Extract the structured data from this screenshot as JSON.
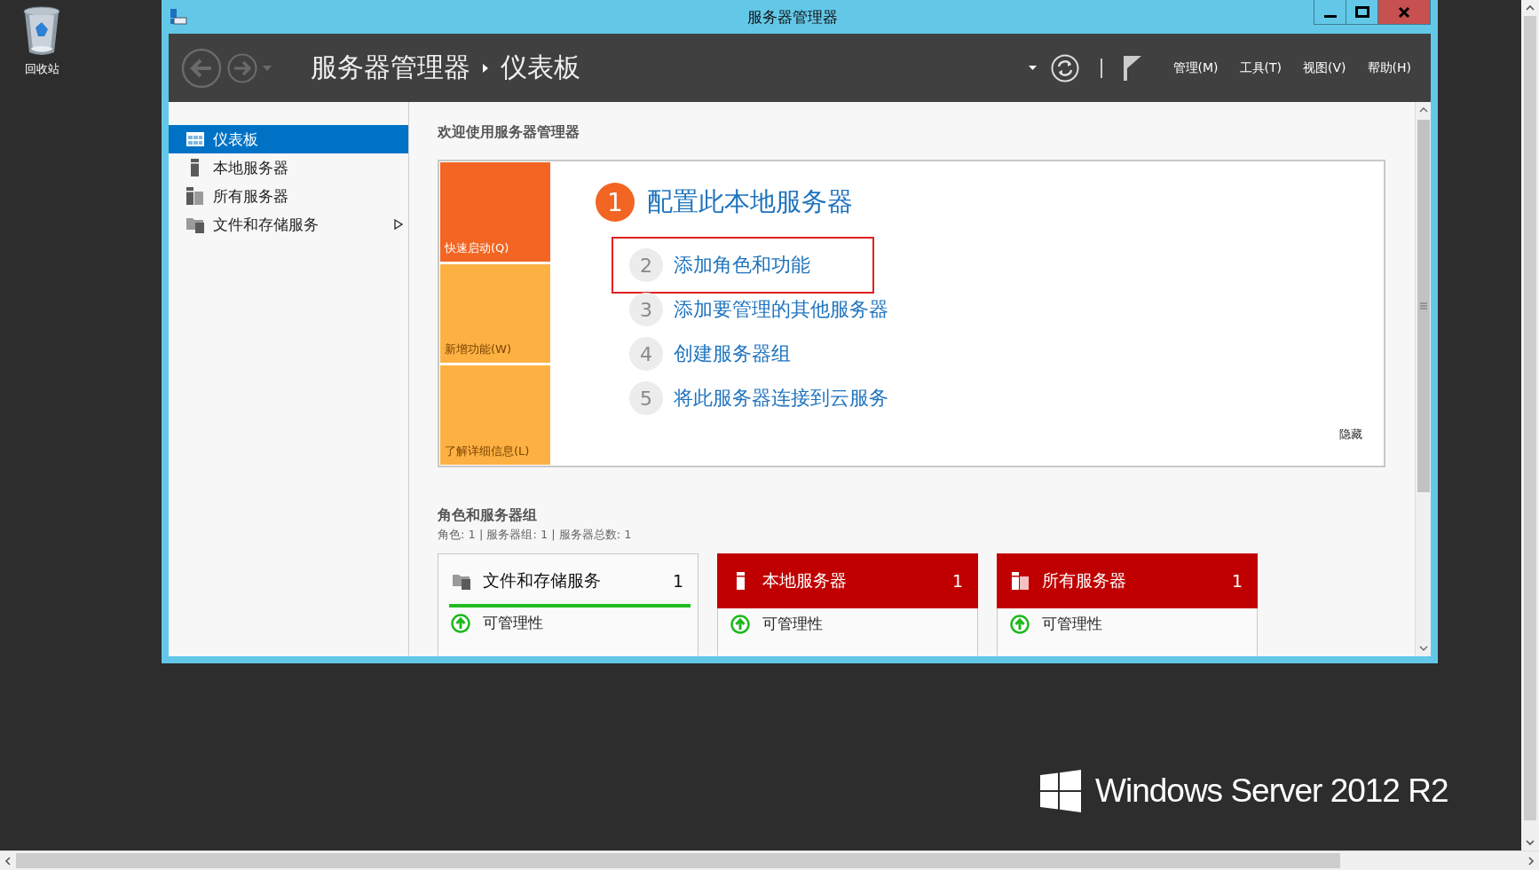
{
  "desktop": {
    "icons": [
      {
        "label": "回收站",
        "kind": "recycle-bin"
      }
    ]
  },
  "window": {
    "title": "服务器管理器"
  },
  "header": {
    "breadcrumb": [
      "服务器管理器",
      "仪表板"
    ],
    "menus": [
      "管理(M)",
      "工具(T)",
      "视图(V)",
      "帮助(H)"
    ]
  },
  "sidebar": {
    "items": [
      {
        "label": "仪表板",
        "kind": "dashboard",
        "selected": true,
        "expandable": false
      },
      {
        "label": "本地服务器",
        "kind": "server",
        "selected": false,
        "expandable": false
      },
      {
        "label": "所有服务器",
        "kind": "servers",
        "selected": false,
        "expandable": false
      },
      {
        "label": "文件和存储服务",
        "kind": "storage",
        "selected": false,
        "expandable": true
      }
    ]
  },
  "welcome": {
    "title": "欢迎使用服务器管理器",
    "tiles": [
      {
        "label": "快速启动(Q)",
        "color": "#f26522"
      },
      {
        "label": "新增功能(W)",
        "color": "#fdb143"
      },
      {
        "label": "了解详细信息(L)",
        "color": "#fdb143"
      }
    ],
    "steps": [
      {
        "number": "1",
        "label": "配置此本地服务器",
        "kind": "heading",
        "highlighted": false
      },
      {
        "number": "2",
        "label": "添加角色和功能",
        "kind": "task",
        "highlighted": true
      },
      {
        "number": "3",
        "label": "添加要管理的其他服务器",
        "kind": "task",
        "highlighted": false
      },
      {
        "number": "4",
        "label": "创建服务器组",
        "kind": "task",
        "highlighted": false
      },
      {
        "number": "5",
        "label": "将此服务器连接到云服务",
        "kind": "task",
        "highlighted": false
      }
    ],
    "hide_link": "隐藏"
  },
  "roles": {
    "title": "角色和服务器组",
    "summary": "角色: 1 | 服务器组: 1 | 服务器总数: 1",
    "cards": [
      {
        "title": "文件和存储服务",
        "count": "1",
        "kind": "storage",
        "alert": false,
        "rows": [
          {
            "label": "可管理性",
            "healthy": true
          }
        ]
      },
      {
        "title": "本地服务器",
        "count": "1",
        "kind": "server",
        "alert": true,
        "rows": [
          {
            "label": "可管理性",
            "healthy": true
          }
        ]
      },
      {
        "title": "所有服务器",
        "count": "1",
        "kind": "servers",
        "alert": true,
        "rows": [
          {
            "label": "可管理性",
            "healthy": true
          }
        ]
      }
    ]
  },
  "brand": {
    "text": "Windows Server 2012 R2"
  }
}
